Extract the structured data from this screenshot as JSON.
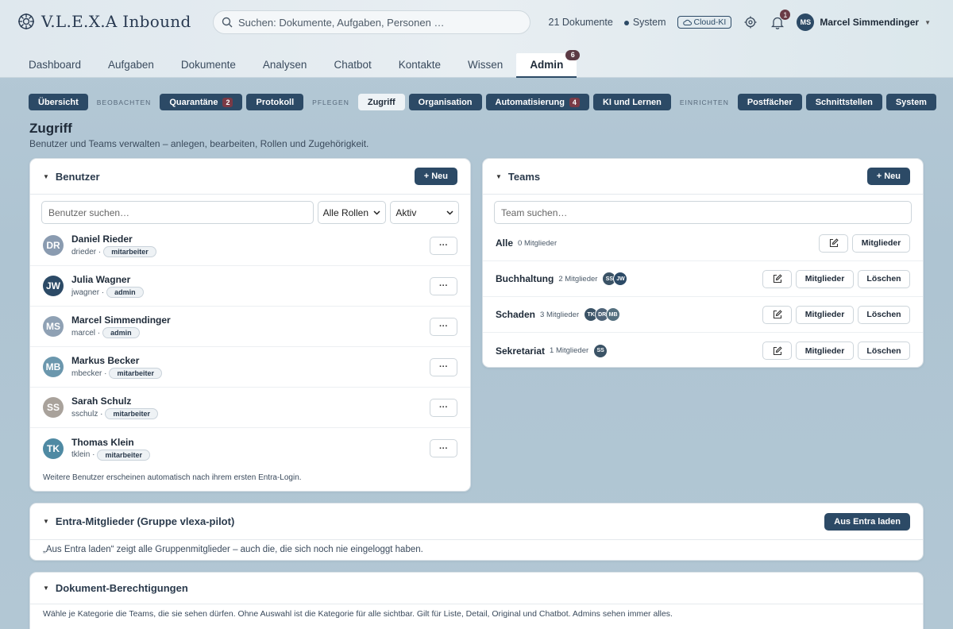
{
  "header": {
    "app_title": "V.L.E.X.A Inbound",
    "search_placeholder": "Suchen: Dokumente, Aufgaben, Personen …",
    "doc_count": "21 Dokumente",
    "system_label": "System",
    "cloud_label": "Cloud-KI",
    "notif_count": "1",
    "user_initials": "MS",
    "user_name": "Marcel Simmendinger"
  },
  "nav": {
    "tabs": [
      "Dashboard",
      "Aufgaben",
      "Dokumente",
      "Analysen",
      "Chatbot",
      "Kontakte",
      "Wissen",
      "Admin"
    ],
    "admin_badge": "6"
  },
  "subnav": {
    "overview": "Übersicht",
    "group_observe": "BEOBACHTEN",
    "quarantine": "Quarantäne",
    "quarantine_count": "2",
    "protocol": "Protokoll",
    "group_maintain": "PFLEGEN",
    "access": "Zugriff",
    "organisation": "Organisation",
    "automation": "Automatisierung",
    "automation_count": "4",
    "ai_learning": "KI und Lernen",
    "group_setup": "EINRICHTEN",
    "mailboxes": "Postfächer",
    "interfaces": "Schnittstellen",
    "system": "System"
  },
  "page": {
    "title": "Zugriff",
    "subtitle": "Benutzer und Teams verwalten – anlegen, bearbeiten, Rollen und Zugehörigkeit."
  },
  "users_card": {
    "title": "Benutzer",
    "new_label": "+ Neu",
    "search_placeholder": "Benutzer suchen…",
    "role_filter": "Alle Rollen",
    "status_filter": "Aktiv",
    "more_label": "···",
    "users": [
      {
        "initials": "DR",
        "name": "Daniel Rieder",
        "login": "drieder ·",
        "role": "mitarbeiter",
        "color": "#8a9bb0"
      },
      {
        "initials": "JW",
        "name": "Julia Wagner",
        "login": "jwagner ·",
        "role": "admin",
        "color": "#2c4a66"
      },
      {
        "initials": "MS",
        "name": "Marcel Simmendinger",
        "login": "marcel ·",
        "role": "admin",
        "color": "#8fa1b4"
      },
      {
        "initials": "MB",
        "name": "Markus Becker",
        "login": "mbecker ·",
        "role": "mitarbeiter",
        "color": "#6b97ad"
      },
      {
        "initials": "SS",
        "name": "Sarah Schulz",
        "login": "sschulz ·",
        "role": "mitarbeiter",
        "color": "#a9a29b"
      },
      {
        "initials": "TK",
        "name": "Thomas Klein",
        "login": "tklein ·",
        "role": "mitarbeiter",
        "color": "#4f8aa3"
      }
    ],
    "footnote": "Weitere Benutzer erscheinen automatisch nach ihrem ersten Entra-Login."
  },
  "teams_card": {
    "title": "Teams",
    "new_label": "+ Neu",
    "search_placeholder": "Team suchen…",
    "members_label": "Mitglieder",
    "delete_label": "Löschen",
    "teams": [
      {
        "name": "Alle",
        "count": "0 Mitglieder",
        "members": []
      },
      {
        "name": "Buchhaltung",
        "count": "2 Mitglieder",
        "members": [
          "SS",
          "JW"
        ]
      },
      {
        "name": "Schaden",
        "count": "3 Mitglieder",
        "members": [
          "TK",
          "DR",
          "MB"
        ]
      },
      {
        "name": "Sekretariat",
        "count": "1 Mitglieder",
        "members": [
          "SS"
        ]
      }
    ]
  },
  "entra_card": {
    "title": "Entra-Mitglieder (Gruppe vlexa-pilot)",
    "load_label": "Aus Entra laden",
    "body": "„Aus Entra laden“ zeigt alle Gruppenmitglieder – auch die, die sich noch nie eingeloggt haben."
  },
  "perm_card": {
    "title": "Dokument-Berechtigungen",
    "body": "Wähle je Kategorie die Teams, die sie sehen dürfen. Ohne Auswahl ist die Kategorie für alle sichtbar. Gilt für Liste, Detail, Original und Chatbot. Admins sehen immer alles."
  }
}
